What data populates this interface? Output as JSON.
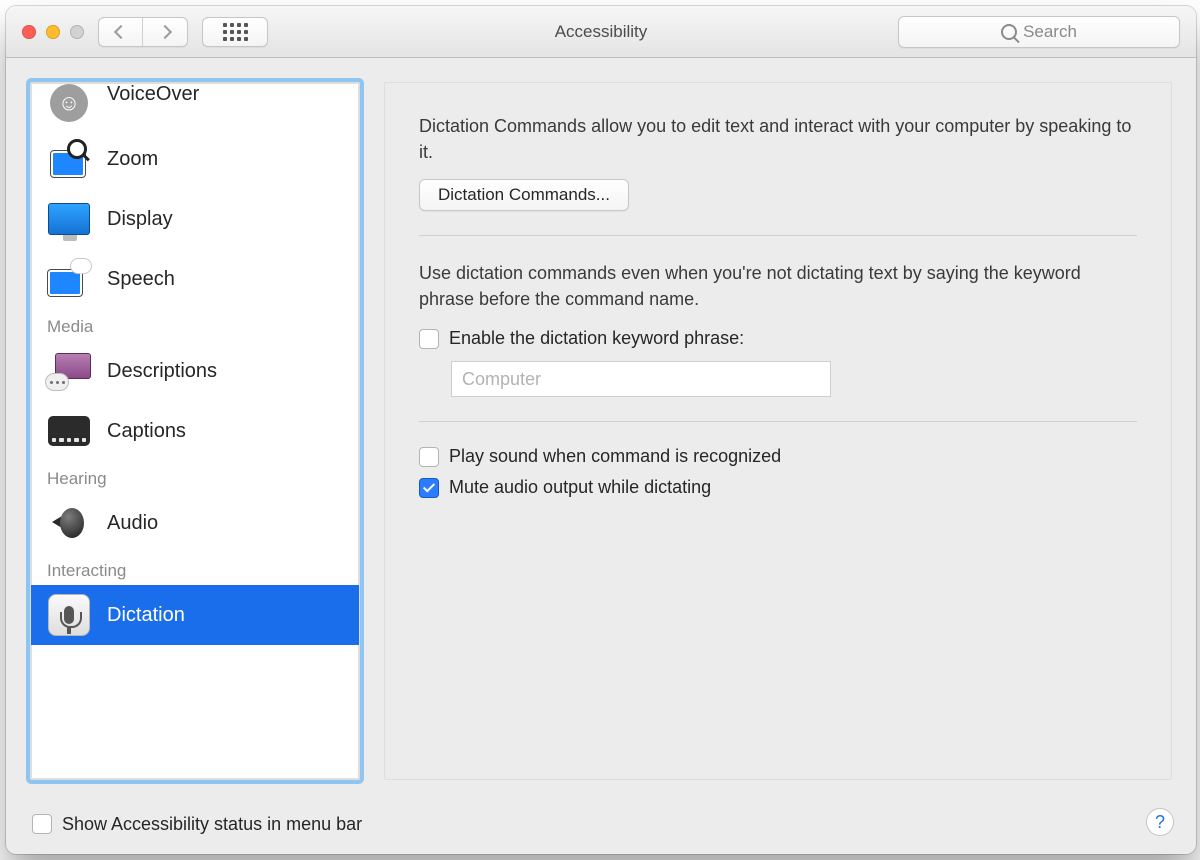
{
  "window": {
    "title": "Accessibility"
  },
  "search": {
    "placeholder": "Search"
  },
  "sidebar": {
    "items": {
      "voiceover": "VoiceOver",
      "zoom": "Zoom",
      "display": "Display",
      "speech": "Speech",
      "descriptions": "Descriptions",
      "captions": "Captions",
      "audio": "Audio",
      "dictation": "Dictation"
    },
    "sections": {
      "media": "Media",
      "hearing": "Hearing",
      "interacting": "Interacting"
    }
  },
  "panel": {
    "intro": "Dictation Commands allow you to edit text and interact with your computer by speaking to it.",
    "btn_commands": "Dictation Commands...",
    "keyword_intro": "Use dictation commands even when you're not dictating text by saying the keyword phrase before the command name.",
    "enable_keyword": "Enable the dictation keyword phrase:",
    "keyword_value": "Computer",
    "play_sound": "Play sound when command is recognized",
    "mute_audio": "Mute audio output while dictating"
  },
  "footer": {
    "show_status": "Show Accessibility status in menu bar"
  },
  "state": {
    "enable_keyword_checked": false,
    "play_sound_checked": false,
    "mute_audio_checked": true,
    "show_status_checked": false
  }
}
